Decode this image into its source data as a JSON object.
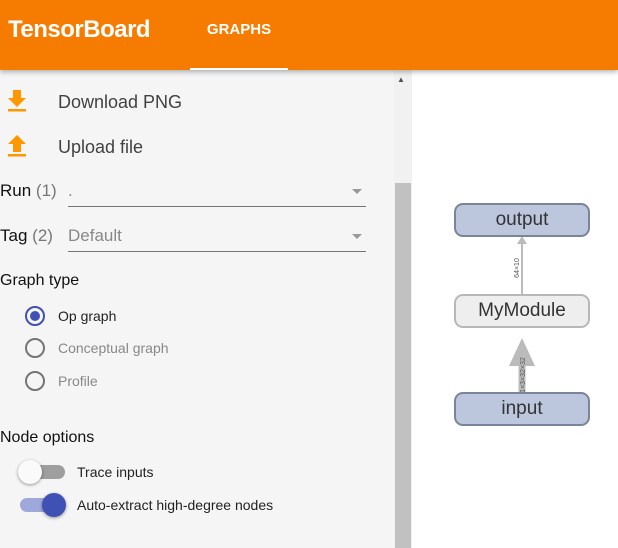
{
  "header": {
    "brand": "TensorBoard",
    "tabs": [
      {
        "label": "GRAPHS",
        "active": true
      }
    ],
    "color": "#f57c00"
  },
  "sidebar": {
    "actions": [
      {
        "label": "Download PNG",
        "icon": "download-icon"
      },
      {
        "label": "Upload file",
        "icon": "upload-icon"
      }
    ],
    "run": {
      "label": "Run",
      "count": "(1)",
      "value": "."
    },
    "tag": {
      "label": "Tag",
      "count": "(2)",
      "value": "Default"
    },
    "graph_type": {
      "title": "Graph type",
      "options": [
        {
          "label": "Op graph",
          "selected": true
        },
        {
          "label": "Conceptual graph",
          "selected": false
        },
        {
          "label": "Profile",
          "selected": false
        }
      ]
    },
    "node_options": {
      "title": "Node options",
      "toggles": [
        {
          "label": "Trace inputs",
          "on": false
        },
        {
          "label": "Auto-extract high-degree nodes",
          "on": true
        }
      ]
    }
  },
  "graph": {
    "nodes": [
      "output",
      "MyModule",
      "input"
    ],
    "edges": [
      {
        "from": "input",
        "to": "MyModule",
        "label": "1×3×32×32"
      },
      {
        "from": "MyModule",
        "to": "output",
        "label": "64×10"
      }
    ]
  }
}
